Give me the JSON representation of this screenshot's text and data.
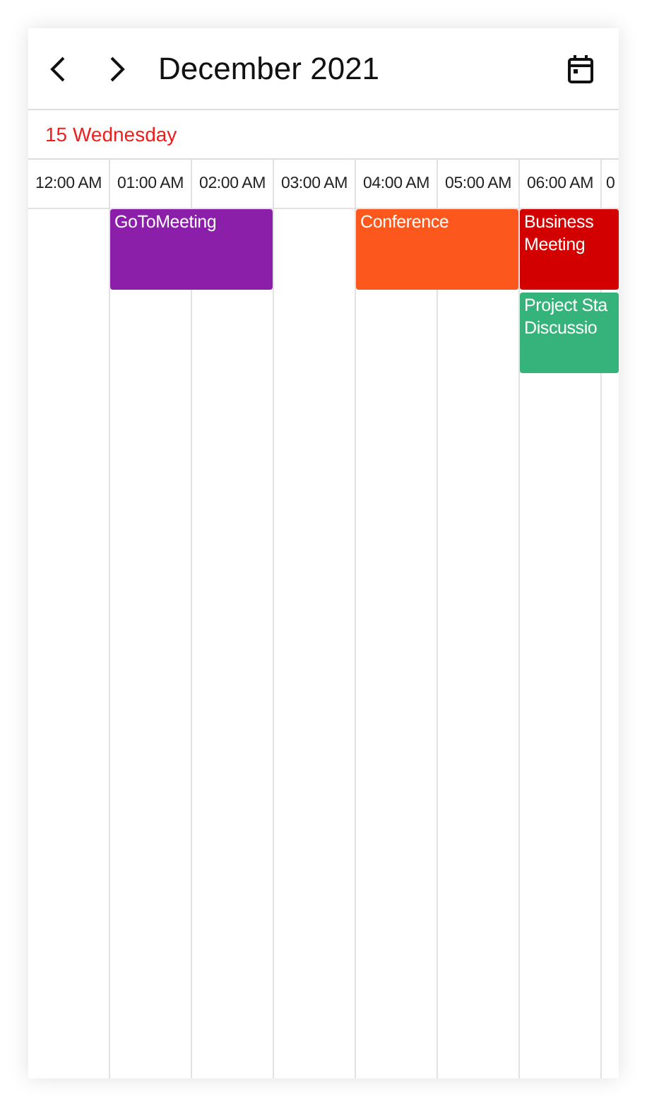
{
  "header": {
    "title": "December 2021"
  },
  "day_label": "15 Wednesday",
  "columns": [
    {
      "label": "12:00 AM"
    },
    {
      "label": "01:00 AM",
      "events": [
        {
          "lines": [
            "GoToMeeting"
          ],
          "color": "#8b1fa9",
          "long": true
        }
      ]
    },
    {
      "label": "02:00 AM"
    },
    {
      "label": "03:00 AM"
    },
    {
      "label": "04:00 AM",
      "events": [
        {
          "lines": [
            "Conference"
          ],
          "color": "#fc571d",
          "long": true
        }
      ]
    },
    {
      "label": "05:00 AM"
    },
    {
      "label": "06:00 AM",
      "events": [
        {
          "lines": [
            "Business",
            "Meeting"
          ],
          "color": "#d20100",
          "long": false
        },
        {
          "lines": [
            "Project Sta",
            "Discussio"
          ],
          "color": "#36b37b",
          "long": false
        }
      ]
    },
    {
      "label": "0"
    }
  ]
}
